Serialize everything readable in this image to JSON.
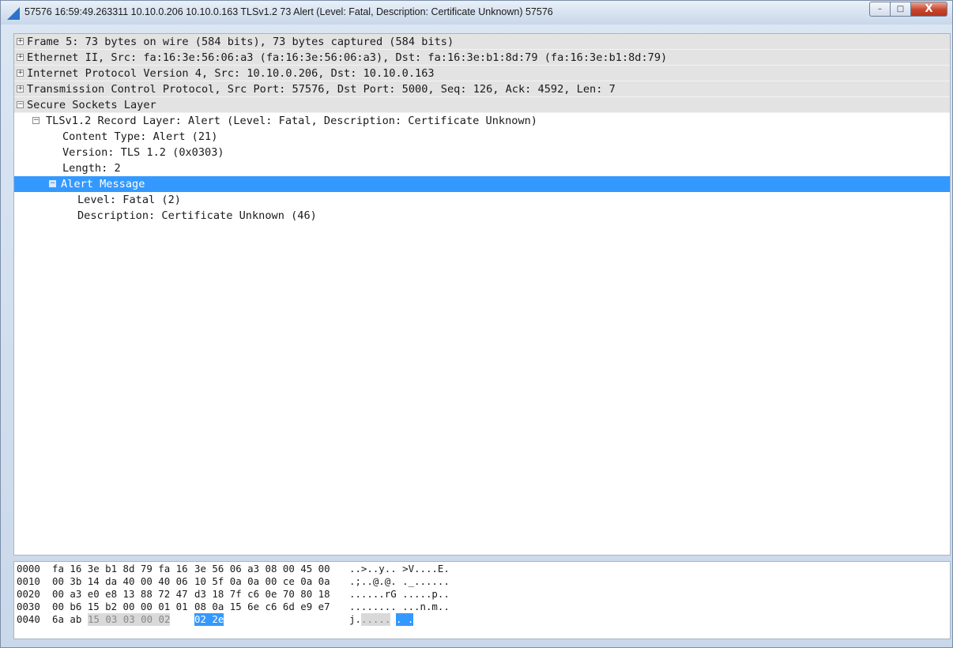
{
  "window": {
    "title": "57576 16:59:49.263311 10.10.0.206 10.10.0.163 TLSv1.2 73  Alert (Level: Fatal, Description: Certificate Unknown)  57576",
    "controls": {
      "minimize": "–",
      "maximize": "□",
      "close": "X"
    }
  },
  "tree": {
    "rows": [
      {
        "label": "Frame 5: 73 bytes on wire (584 bits), 73 bytes captured (584 bits)",
        "expander": "+"
      },
      {
        "label": "Ethernet II, Src: fa:16:3e:56:06:a3 (fa:16:3e:56:06:a3), Dst: fa:16:3e:b1:8d:79 (fa:16:3e:b1:8d:79)",
        "expander": "+"
      },
      {
        "label": "Internet Protocol Version 4, Src: 10.10.0.206, Dst: 10.10.0.163",
        "expander": "+"
      },
      {
        "label": "Transmission Control Protocol, Src Port: 57576, Dst Port: 5000, Seq: 126, Ack: 4592, Len: 7",
        "expander": "+"
      },
      {
        "label": "Secure Sockets Layer",
        "expander": "−"
      },
      {
        "label": "TLSv1.2 Record Layer: Alert (Level: Fatal, Description: Certificate Unknown)",
        "expander": "−"
      },
      {
        "label": "Content Type: Alert (21)"
      },
      {
        "label": "Version: TLS 1.2 (0x0303)"
      },
      {
        "label": "Length: 2"
      },
      {
        "label": "Alert Message",
        "expander": "−"
      },
      {
        "label": "Level: Fatal (2)"
      },
      {
        "label": "Description: Certificate Unknown (46)"
      }
    ]
  },
  "bytes": {
    "rows": [
      {
        "offset": "0000",
        "hex_a": "fa 16 3e b1 8d 79 fa 16",
        "hex_b": "3e 56 06 a3 08 00 45 00",
        "ascii": "..>..y.. >V....E."
      },
      {
        "offset": "0010",
        "hex_a": "00 3b 14 da 40 00 40 06",
        "hex_b": "10 5f 0a 0a 00 ce 0a 0a",
        "ascii": ".;..@.@. ._......"
      },
      {
        "offset": "0020",
        "hex_a": "00 a3 e0 e8 13 88 72 47",
        "hex_b": "d3 18 7f c6 0e 70 80 18",
        "ascii": "......rG .....p.."
      },
      {
        "offset": "0030",
        "hex_a": "00 b6 15 b2 00 00 01 01",
        "hex_b": "08 0a 15 6e c6 6d e9 e7",
        "ascii": "........ ...n.m.."
      },
      {
        "offset": "0040",
        "hex_plain": "6a ab",
        "hex_field": "15 03 03 00 02",
        "hex_sel": "02 2e",
        "ascii_plain": "j.",
        "ascii_field": ".....",
        "ascii_sel": ". ."
      }
    ]
  },
  "colors": {
    "selection": "#3399ff",
    "shaded_row": "#e3e3e3",
    "field_highlight": "#d9d9d9",
    "close_button": "#c8452c"
  }
}
